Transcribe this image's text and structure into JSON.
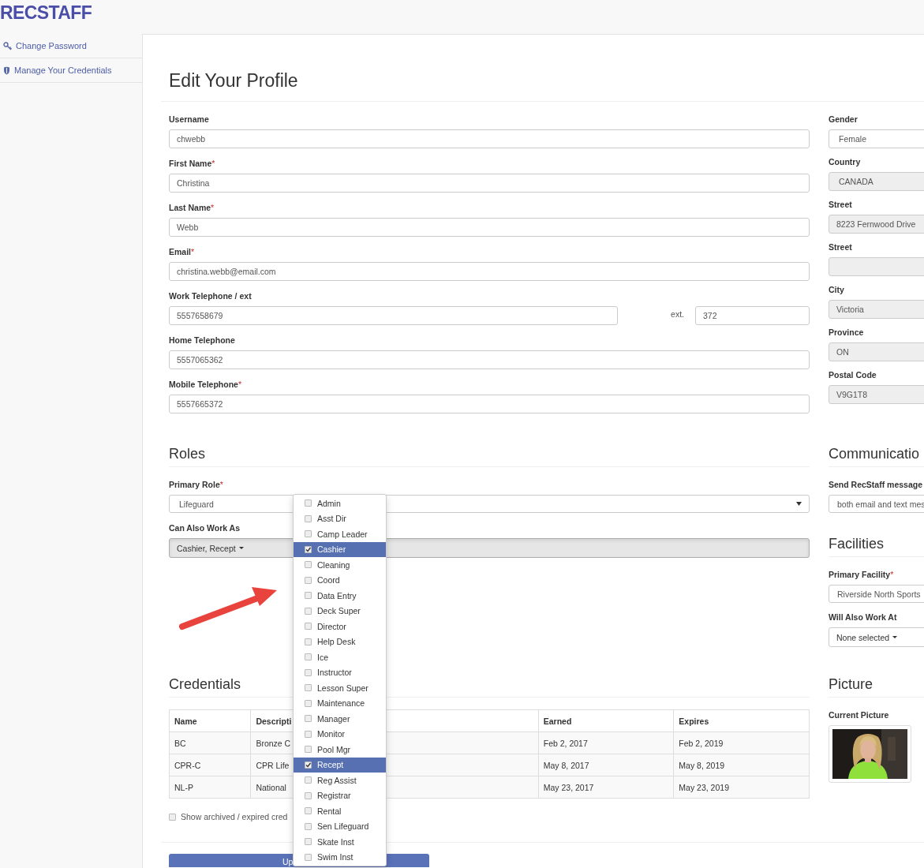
{
  "logo": "RECSTAFF",
  "required_mark": "*",
  "sidebar": {
    "items": [
      {
        "label": "Change Password"
      },
      {
        "label": "Manage Your Credentials"
      }
    ]
  },
  "page_title": "Edit Your Profile",
  "personal_fields": [
    {
      "label": "Username",
      "required": false,
      "value": "chwebb"
    },
    {
      "label": "First Name",
      "required": true,
      "value": "Christina"
    },
    {
      "label": "Last Name",
      "required": true,
      "value": "Webb"
    },
    {
      "label": "Email",
      "required": true,
      "value": "christina.webb@email.com"
    },
    {
      "label": "Work Telephone / ext",
      "required": false,
      "value": "5557658679",
      "ext_label": "ext.",
      "ext_value": "372"
    },
    {
      "label": "Home Telephone",
      "required": false,
      "value": "5557065362"
    },
    {
      "label": "Mobile Telephone",
      "required": true,
      "value": "5557665372"
    }
  ],
  "address_fields": [
    {
      "label": "Gender",
      "value": "Female",
      "disabled": false
    },
    {
      "label": "Country",
      "value": "CANADA",
      "disabled": true
    },
    {
      "label": "Street",
      "value": "8223 Fernwood Drive",
      "disabled": true
    },
    {
      "label": "Street",
      "disabled": true
    },
    {
      "label": "City",
      "value": "Victoria",
      "disabled": true
    },
    {
      "label": "Province",
      "value": "ON",
      "disabled": true
    },
    {
      "label": "Postal Code",
      "value": "V9G1T8",
      "disabled": true
    }
  ],
  "roles": {
    "title": "Roles",
    "primary_role": {
      "label": "Primary Role",
      "required": true,
      "value": "Lifeguard"
    },
    "also_work_as": {
      "label": "Can Also Work As",
      "value": "Cashier, Recept"
    },
    "options": [
      {
        "label": "Admin",
        "checked": false
      },
      {
        "label": "Asst Dir",
        "checked": false
      },
      {
        "label": "Camp Leader",
        "checked": false
      },
      {
        "label": "Cashier",
        "checked": true
      },
      {
        "label": "Cleaning",
        "checked": false
      },
      {
        "label": "Coord",
        "checked": false
      },
      {
        "label": "Data Entry",
        "checked": false
      },
      {
        "label": "Deck Super",
        "checked": false
      },
      {
        "label": "Director",
        "checked": false
      },
      {
        "label": "Help Desk",
        "checked": false
      },
      {
        "label": "Ice",
        "checked": false
      },
      {
        "label": "Instructor",
        "checked": false
      },
      {
        "label": "Lesson Super",
        "checked": false
      },
      {
        "label": "Maintenance",
        "checked": false
      },
      {
        "label": "Manager",
        "checked": false
      },
      {
        "label": "Monitor",
        "checked": false
      },
      {
        "label": "Pool Mgr",
        "checked": false
      },
      {
        "label": "Recept",
        "checked": true
      },
      {
        "label": "Reg Assist",
        "checked": false
      },
      {
        "label": "Registrar",
        "checked": false
      },
      {
        "label": "Rental",
        "checked": false
      },
      {
        "label": "Sen Lifeguard",
        "checked": false
      },
      {
        "label": "Skate Inst",
        "checked": false
      },
      {
        "label": "Swim Inst",
        "checked": false
      }
    ]
  },
  "credentials": {
    "title": "Credentials",
    "columns": [
      "Name",
      "Descripti",
      "Earned",
      "Expires"
    ],
    "rows": [
      [
        "BC",
        "Bronze C",
        "Feb 2, 2017",
        "Feb 2, 2019"
      ],
      [
        "CPR-C",
        "CPR Life",
        "May 8, 2017",
        "May 8, 2019"
      ],
      [
        "NL-P",
        "National",
        "May 23, 2017",
        "May 23, 2019"
      ]
    ],
    "show_archived": {
      "label": "Show archived / expired cred",
      "checked": false
    }
  },
  "update_button": "Up",
  "communication": {
    "title": "Communicatio",
    "label": "Send RecStaff message",
    "value": "both email and text mes"
  },
  "facilities": {
    "title": "Facilities",
    "primary": {
      "label": "Primary Facility",
      "required": true,
      "value": "Riverside North Sports"
    },
    "also": {
      "label": "Will Also Work At",
      "value": "None selected"
    }
  },
  "picture": {
    "title": "Picture",
    "label": "Current Picture"
  }
}
